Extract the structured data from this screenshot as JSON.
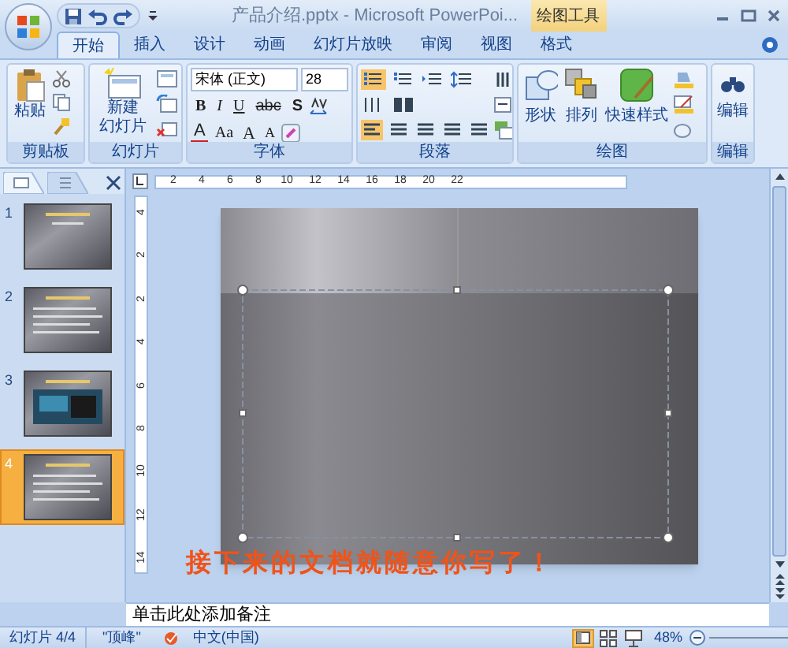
{
  "title_bar": {
    "title": "产品介绍.pptx - Microsoft PowerPoi...",
    "context_tab": "绘图工具"
  },
  "tabs": [
    {
      "label": "开始",
      "selected": true
    },
    {
      "label": "插入",
      "selected": false
    },
    {
      "label": "设计",
      "selected": false
    },
    {
      "label": "动画",
      "selected": false
    },
    {
      "label": "幻灯片放映",
      "selected": false
    },
    {
      "label": "审阅",
      "selected": false
    },
    {
      "label": "视图",
      "selected": false
    },
    {
      "label": "格式",
      "selected": false
    }
  ],
  "ribbon": {
    "clipboard": {
      "label": "剪贴板",
      "paste": "粘贴"
    },
    "slides": {
      "label": "幻灯片",
      "new_slide": [
        "新建",
        "幻灯片"
      ]
    },
    "font": {
      "label": "字体",
      "font_name": "宋体 (正文)",
      "font_size": "28",
      "styles": [
        "B",
        "I",
        "U",
        "abc",
        "S"
      ],
      "row3": [
        "A",
        "Aa",
        "A",
        "A"
      ]
    },
    "paragraph": {
      "label": "段落"
    },
    "drawing": {
      "label": "绘图",
      "buttons": [
        "形状",
        "排列",
        "快速样式"
      ]
    },
    "editing": {
      "label": "编辑",
      "button": "编辑"
    }
  },
  "slide_panel": {
    "thumbnails": [
      {
        "number": "1",
        "selected": false
      },
      {
        "number": "2",
        "selected": false
      },
      {
        "number": "3",
        "selected": false
      },
      {
        "number": "4",
        "selected": true
      }
    ]
  },
  "rulers": {
    "horizontal": [
      "2",
      "4",
      "6",
      "8",
      "10",
      "12",
      "14",
      "16",
      "18",
      "20",
      "22"
    ],
    "vertical": [
      "4",
      "2",
      "2",
      "4",
      "6",
      "8",
      "10",
      "12",
      "14"
    ]
  },
  "slide": {
    "annotation": "接下来的文档就随意你写了！"
  },
  "notes": {
    "text": "单击此处添加备注"
  },
  "status_bar": {
    "slide": "幻灯片 4/4",
    "theme": "\"顶峰\"",
    "language": "中文(中国)",
    "zoom": "48%",
    "views": [
      {
        "kind": "normal",
        "selected": true
      },
      {
        "kind": "sorter",
        "selected": false
      },
      {
        "kind": "show",
        "selected": false
      }
    ]
  }
}
